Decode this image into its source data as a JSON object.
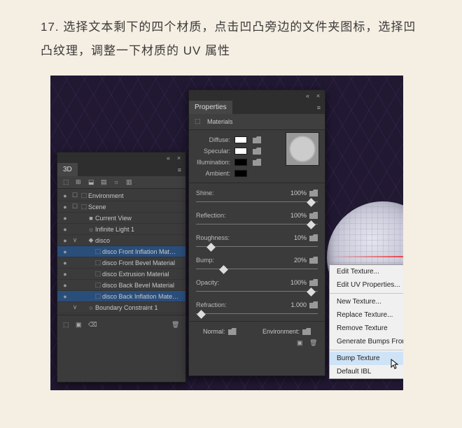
{
  "instruction": {
    "number": "17.",
    "text": "选择文本剩下的四个材质，点击凹凸旁边的文件夹图标，选择凹凸纹理，调整一下材质的 UV 属性"
  },
  "panel3d": {
    "title": "3D",
    "items": [
      {
        "eye": "●",
        "toggle": "☐",
        "indent": 0,
        "glyph": "⬚",
        "label": "Environment"
      },
      {
        "eye": "●",
        "toggle": "☐",
        "indent": 0,
        "glyph": "⬚",
        "label": "Scene"
      },
      {
        "eye": "●",
        "toggle": "",
        "indent": 1,
        "glyph": "■",
        "label": "Current View"
      },
      {
        "eye": "●",
        "toggle": "",
        "indent": 1,
        "glyph": "☼",
        "label": "Infinite Light 1"
      },
      {
        "eye": "●",
        "toggle": "∨",
        "indent": 1,
        "glyph": "◆",
        "label": "disco"
      },
      {
        "eye": "●",
        "toggle": "",
        "indent": 2,
        "glyph": "⬚",
        "label": "disco Front Inflation Mat…",
        "sel": true
      },
      {
        "eye": "●",
        "toggle": "",
        "indent": 2,
        "glyph": "⬚",
        "label": "disco Front Bevel Material"
      },
      {
        "eye": "●",
        "toggle": "",
        "indent": 2,
        "glyph": "⬚",
        "label": "disco Extrusion Material"
      },
      {
        "eye": "●",
        "toggle": "",
        "indent": 2,
        "glyph": "⬚",
        "label": "disco Back Bevel Material"
      },
      {
        "eye": "●",
        "toggle": "",
        "indent": 2,
        "glyph": "⬚",
        "label": "disco Back Inflation Mate…",
        "sel": true
      },
      {
        "eye": "",
        "toggle": "∨",
        "indent": 1,
        "glyph": "○",
        "label": "Boundary Constraint 1"
      }
    ]
  },
  "properties": {
    "title": "Properties",
    "section": "Materials",
    "color_labels": {
      "diffuse": "Diffuse:",
      "specular": "Specular:",
      "illumination": "Illumination:",
      "ambient": "Ambient:"
    },
    "sliders": {
      "shine": {
        "label": "Shine:",
        "value": "100%",
        "pos": 92
      },
      "reflection": {
        "label": "Reflection:",
        "value": "100%",
        "pos": 92
      },
      "roughness": {
        "label": "Roughness:",
        "value": "10%",
        "pos": 10
      },
      "bump": {
        "label": "Bump:",
        "value": "20%",
        "pos": 20
      },
      "opacity": {
        "label": "Opacity:",
        "value": "100%",
        "pos": 92
      },
      "refraction": {
        "label": "Refraction:",
        "value": "1.000",
        "pos": 2
      }
    },
    "footer": {
      "normal": "Normal:",
      "environment": "Environment:"
    }
  },
  "menu": {
    "items": [
      {
        "label": "Edit Texture..."
      },
      {
        "label": "Edit UV Properties..."
      },
      {
        "sep": true
      },
      {
        "label": "New Texture..."
      },
      {
        "label": "Replace Texture..."
      },
      {
        "label": "Remove Texture"
      },
      {
        "label": "Generate Bumps From I"
      },
      {
        "sep": true
      },
      {
        "label": "Bump Texture",
        "hl": true
      },
      {
        "label": "Default IBL"
      }
    ]
  }
}
